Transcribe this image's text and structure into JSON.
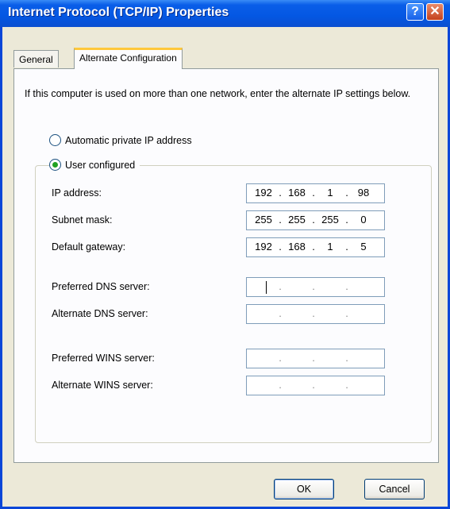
{
  "window": {
    "title": "Internet Protocol (TCP/IP) Properties",
    "help_glyph": "?",
    "close_glyph": "✕"
  },
  "tabs": [
    {
      "label": "General"
    },
    {
      "label": "Alternate Configuration"
    }
  ],
  "description": "If this computer is used on more than one network, enter the alternate IP settings below.",
  "radios": {
    "automatic": {
      "label": "Automatic private IP address",
      "checked": false
    },
    "user": {
      "label": "User configured",
      "checked": true
    }
  },
  "fields": [
    {
      "label": "IP address:",
      "octets": [
        "192",
        "168",
        "1",
        "98"
      ]
    },
    {
      "label": "Subnet mask:",
      "octets": [
        "255",
        "255",
        "255",
        "0"
      ]
    },
    {
      "label": "Default gateway:",
      "octets": [
        "192",
        "168",
        "1",
        "5"
      ]
    },
    {
      "label": "Preferred DNS server:",
      "octets": [
        "",
        "",
        "",
        ""
      ]
    },
    {
      "label": "Alternate DNS server:",
      "octets": [
        "",
        "",
        "",
        ""
      ]
    },
    {
      "label": "Preferred WINS server:",
      "octets": [
        "",
        "",
        "",
        ""
      ]
    },
    {
      "label": "Alternate WINS server:",
      "octets": [
        "",
        "",
        "",
        ""
      ]
    }
  ],
  "buttons": {
    "ok": "OK",
    "cancel": "Cancel"
  }
}
